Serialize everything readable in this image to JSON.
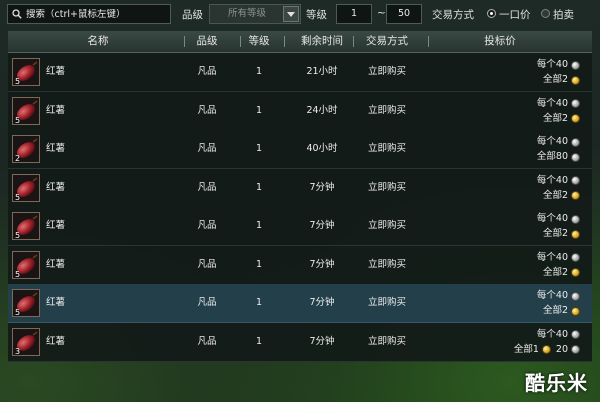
{
  "search": {
    "placeholder": "搜索（ctrl+鼠标左键）"
  },
  "filters": {
    "grade_label": "品级",
    "grade_value": "所有等级",
    "level_label": "等级",
    "level_min": "1",
    "level_sep": "~",
    "level_max": "50",
    "trade_label": "交易方式",
    "trade_options": [
      {
        "label": "一口价",
        "selected": true
      },
      {
        "label": "拍卖",
        "selected": false
      }
    ]
  },
  "columns": {
    "name": "名称",
    "grade": "品级",
    "level": "等级",
    "time": "剩余时间",
    "trade": "交易方式",
    "price": "投标价"
  },
  "rows": [
    {
      "qty": "5",
      "name": "红薯",
      "grade": "凡品",
      "level": "1",
      "time": "21小时",
      "trade": "立即购买",
      "price_each_label": "每个40",
      "price_each_coin": "silver",
      "price_total_label": "全部2",
      "price_total_coin": "gold",
      "price_total_extra": "",
      "selected": false
    },
    {
      "qty": "5",
      "name": "红薯",
      "grade": "凡品",
      "level": "1",
      "time": "24小时",
      "trade": "立即购买",
      "price_each_label": "每个40",
      "price_each_coin": "silver",
      "price_total_label": "全部2",
      "price_total_coin": "gold",
      "price_total_extra": "",
      "selected": false
    },
    {
      "qty": "2",
      "name": "红薯",
      "grade": "凡品",
      "level": "1",
      "time": "40小时",
      "trade": "立即购买",
      "price_each_label": "每个40",
      "price_each_coin": "silver",
      "price_total_label": "全部80",
      "price_total_coin": "silver",
      "price_total_extra": "",
      "selected": false
    },
    {
      "qty": "5",
      "name": "红薯",
      "grade": "凡品",
      "level": "1",
      "time": "7分钟",
      "trade": "立即购买",
      "price_each_label": "每个40",
      "price_each_coin": "silver",
      "price_total_label": "全部2",
      "price_total_coin": "gold",
      "price_total_extra": "",
      "selected": false
    },
    {
      "qty": "5",
      "name": "红薯",
      "grade": "凡品",
      "level": "1",
      "time": "7分钟",
      "trade": "立即购买",
      "price_each_label": "每个40",
      "price_each_coin": "silver",
      "price_total_label": "全部2",
      "price_total_coin": "gold",
      "price_total_extra": "",
      "selected": false
    },
    {
      "qty": "5",
      "name": "红薯",
      "grade": "凡品",
      "level": "1",
      "time": "7分钟",
      "trade": "立即购买",
      "price_each_label": "每个40",
      "price_each_coin": "silver",
      "price_total_label": "全部2",
      "price_total_coin": "gold",
      "price_total_extra": "",
      "selected": false
    },
    {
      "qty": "5",
      "name": "红薯",
      "grade": "凡品",
      "level": "1",
      "time": "7分钟",
      "trade": "立即购买",
      "price_each_label": "每个40",
      "price_each_coin": "silver",
      "price_total_label": "全部2",
      "price_total_coin": "gold",
      "price_total_extra": "",
      "selected": true
    },
    {
      "qty": "3",
      "name": "红薯",
      "grade": "凡品",
      "level": "1",
      "time": "7分钟",
      "trade": "立即购买",
      "price_each_label": "每个40",
      "price_each_coin": "silver",
      "price_total_label": "全部1",
      "price_total_coin": "gold",
      "price_total_extra": "20",
      "selected": false
    }
  ],
  "watermark": "酷乐米",
  "colors": {
    "selected_row": "#233f4a",
    "header_bg": "#3a4a45",
    "gold_coin": "#d9a623",
    "silver_coin": "#a7a7a7"
  },
  "icons": {
    "search": "search-icon",
    "item": "sweet-potato-icon",
    "dropdown": "chevron-down-icon"
  }
}
